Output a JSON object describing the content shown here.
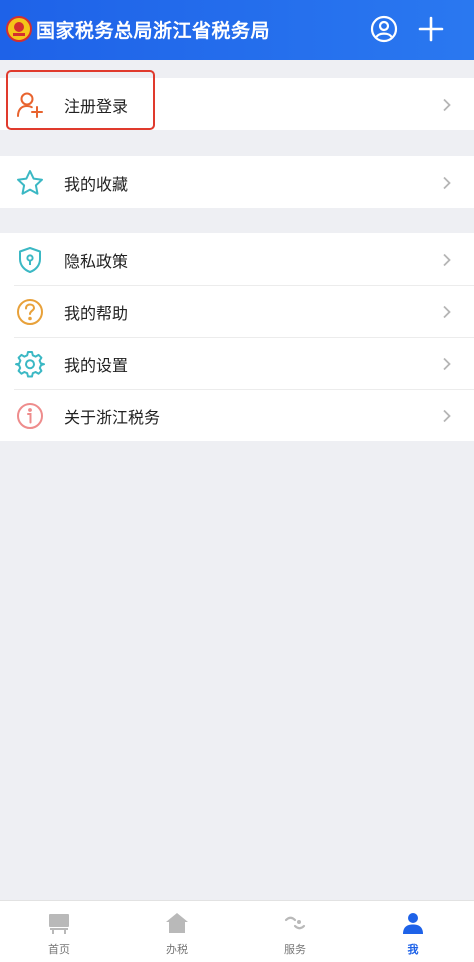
{
  "header": {
    "title": "国家税务总局浙江省税务局",
    "emblem_icon": "tax-emblem-icon",
    "user_icon": "user-circle-icon",
    "add_icon": "plus-icon"
  },
  "colors": {
    "header_bg": "#1e62e8",
    "accent_orange": "#e8632e",
    "accent_teal": "#3bb8c4",
    "highlight_red": "#e03a2d",
    "tab_active": "#1e62e8"
  },
  "menu": {
    "register_login": "注册登录",
    "favorites": "我的收藏",
    "privacy": "隐私政策",
    "help": "我的帮助",
    "settings": "我的设置",
    "about": "关于浙江税务"
  },
  "tabbar": {
    "tabs": [
      {
        "label": "首页",
        "icon": "home-board-icon"
      },
      {
        "label": "办税",
        "icon": "house-icon"
      },
      {
        "label": "服务",
        "icon": "service-icon"
      },
      {
        "label": "我",
        "icon": "person-icon"
      }
    ],
    "active": "我"
  }
}
